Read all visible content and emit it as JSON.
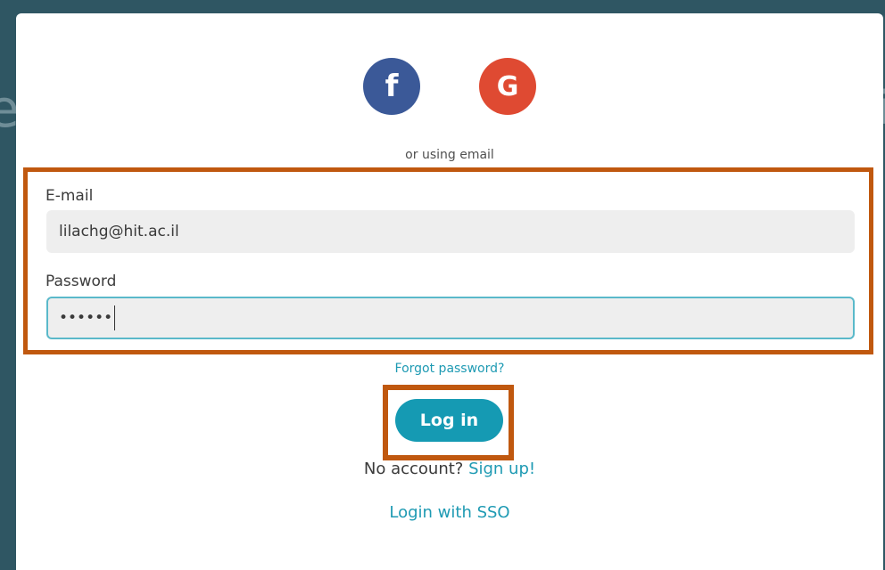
{
  "background": {
    "left_glyph": "e",
    "right_glyph": "i"
  },
  "social": {
    "facebook_glyph": "f",
    "google_glyph": "G",
    "facebook_color": "#3b5998",
    "google_color": "#df4a32"
  },
  "form": {
    "divider_text": "or using email",
    "email_label": "E-mail",
    "email_value": "lilachg@hit.ac.il",
    "password_label": "Password",
    "password_value": "••••••",
    "forgot_text": "Forgot password?",
    "login_label": "Log in",
    "no_account_text": "No account?",
    "signup_text": "Sign up!",
    "sso_text": "Login with SSO"
  },
  "colors": {
    "accent": "#1e9ab3",
    "highlight": "#c0580f",
    "backdrop": "#2f5663"
  }
}
